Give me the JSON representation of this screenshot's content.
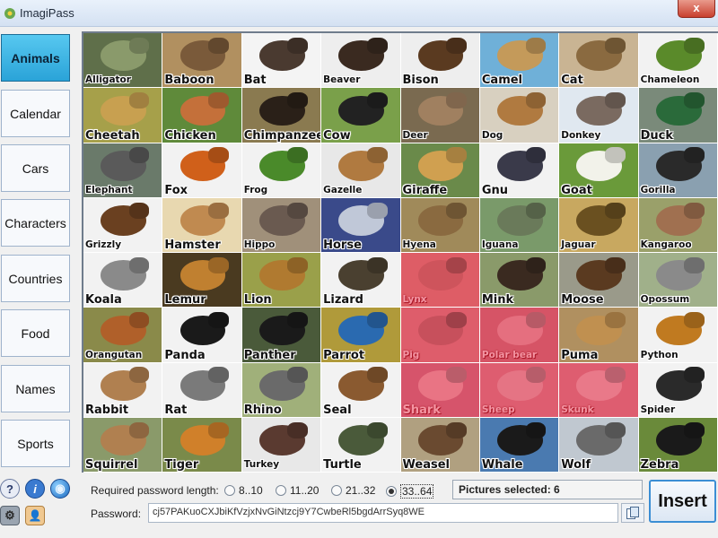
{
  "window": {
    "title": "ImagiPass",
    "close_glyph": "x"
  },
  "categories": [
    {
      "label": "Animals",
      "active": true
    },
    {
      "label": "Calendar",
      "active": false
    },
    {
      "label": "Cars",
      "active": false
    },
    {
      "label": "Characters",
      "active": false
    },
    {
      "label": "Countries",
      "active": false
    },
    {
      "label": "Food",
      "active": false
    },
    {
      "label": "Names",
      "active": false
    },
    {
      "label": "Sports",
      "active": false
    }
  ],
  "tiles": [
    {
      "label": "Alligator",
      "bg": "#5f6f4a",
      "fg": "#8a9a6b",
      "small": true,
      "selected": false
    },
    {
      "label": "Baboon",
      "bg": "#b19060",
      "fg": "#7a5a3a",
      "small": false,
      "selected": false
    },
    {
      "label": "Bat",
      "bg": "#f4f4f4",
      "fg": "#4a3a30",
      "small": false,
      "selected": false
    },
    {
      "label": "Beaver",
      "bg": "#eeeeee",
      "fg": "#3a2a20",
      "small": true,
      "selected": false
    },
    {
      "label": "Bison",
      "bg": "#eeeeee",
      "fg": "#5a3a20",
      "small": false,
      "selected": false
    },
    {
      "label": "Camel",
      "bg": "#6fb0d8",
      "fg": "#c49a5a",
      "small": false,
      "selected": false
    },
    {
      "label": "Cat",
      "bg": "#c9b493",
      "fg": "#8a6a40",
      "small": false,
      "selected": false
    },
    {
      "label": "Chameleon",
      "bg": "#f2f2f2",
      "fg": "#5a8a2a",
      "small": true,
      "selected": false
    },
    {
      "label": "Cheetah",
      "bg": "#a6a04a",
      "fg": "#c8a050",
      "small": false,
      "selected": false
    },
    {
      "label": "Chicken",
      "bg": "#5f8a3a",
      "fg": "#c4703a",
      "small": false,
      "selected": false
    },
    {
      "label": "Chimpanzee",
      "bg": "#8a7a50",
      "fg": "#2a2018",
      "small": false,
      "selected": false
    },
    {
      "label": "Cow",
      "bg": "#7aa04a",
      "fg": "#222222",
      "small": false,
      "selected": false
    },
    {
      "label": "Deer",
      "bg": "#7a6a50",
      "fg": "#a08060",
      "small": true,
      "selected": false
    },
    {
      "label": "Dog",
      "bg": "#d8d0c0",
      "fg": "#b07a40",
      "small": true,
      "selected": false
    },
    {
      "label": "Donkey",
      "bg": "#e0e8f0",
      "fg": "#7a6a60",
      "small": true,
      "selected": false
    },
    {
      "label": "Duck",
      "bg": "#7a8a7a",
      "fg": "#2a6a3a",
      "small": false,
      "selected": false
    },
    {
      "label": "Elephant",
      "bg": "#6a7a6a",
      "fg": "#5a5a5a",
      "small": true,
      "selected": false
    },
    {
      "label": "Fox",
      "bg": "#f2f2f2",
      "fg": "#d0601a",
      "small": false,
      "selected": false
    },
    {
      "label": "Frog",
      "bg": "#f2f2f2",
      "fg": "#4a8a2a",
      "small": true,
      "selected": false
    },
    {
      "label": "Gazelle",
      "bg": "#e8e8e8",
      "fg": "#b07a40",
      "small": true,
      "selected": false
    },
    {
      "label": "Giraffe",
      "bg": "#6a8a4a",
      "fg": "#d0a050",
      "small": false,
      "selected": false
    },
    {
      "label": "Gnu",
      "bg": "#f2f2f2",
      "fg": "#3a3a4a",
      "small": false,
      "selected": false
    },
    {
      "label": "Goat",
      "bg": "#6a9a3a",
      "fg": "#f2f2ea",
      "small": false,
      "selected": false
    },
    {
      "label": "Gorilla",
      "bg": "#8aa0b0",
      "fg": "#2a2a2a",
      "small": true,
      "selected": false
    },
    {
      "label": "Grizzly",
      "bg": "#f2f2f2",
      "fg": "#6a4020",
      "small": true,
      "selected": false
    },
    {
      "label": "Hamster",
      "bg": "#e8d8b0",
      "fg": "#c08a50",
      "small": false,
      "selected": false
    },
    {
      "label": "Hippo",
      "bg": "#a0907a",
      "fg": "#6a5a50",
      "small": true,
      "selected": false
    },
    {
      "label": "Horse",
      "bg": "#3a4a8a",
      "fg": "#c0c8d8",
      "small": false,
      "selected": false
    },
    {
      "label": "Hyena",
      "bg": "#a08a5a",
      "fg": "#8a6a40",
      "small": true,
      "selected": false
    },
    {
      "label": "Iguana",
      "bg": "#7a9a6a",
      "fg": "#6a7a5a",
      "small": true,
      "selected": false
    },
    {
      "label": "Jaguar",
      "bg": "#c8a860",
      "fg": "#6a5020",
      "small": true,
      "selected": false
    },
    {
      "label": "Kangaroo",
      "bg": "#9aa06a",
      "fg": "#a07050",
      "small": true,
      "selected": false
    },
    {
      "label": "Koala",
      "bg": "#f2f2f2",
      "fg": "#8a8a8a",
      "small": false,
      "selected": false
    },
    {
      "label": "Lemur",
      "bg": "#4a3a20",
      "fg": "#c08030",
      "small": false,
      "selected": false
    },
    {
      "label": "Lion",
      "bg": "#9aa04a",
      "fg": "#b07a30",
      "small": false,
      "selected": false
    },
    {
      "label": "Lizard",
      "bg": "#f2f2f2",
      "fg": "#4a4030",
      "small": false,
      "selected": false
    },
    {
      "label": "Lynx",
      "bg": "#e8a0a0",
      "fg": "#d89090",
      "small": true,
      "selected": true
    },
    {
      "label": "Mink",
      "bg": "#8a9a6a",
      "fg": "#3a2a20",
      "small": false,
      "selected": false
    },
    {
      "label": "Moose",
      "bg": "#9a9a8a",
      "fg": "#5a3a20",
      "small": false,
      "selected": false
    },
    {
      "label": "Opossum",
      "bg": "#a0b08a",
      "fg": "#8a8a8a",
      "small": true,
      "selected": false
    },
    {
      "label": "Orangutan",
      "bg": "#8a8a4a",
      "fg": "#b0602a",
      "small": true,
      "selected": false
    },
    {
      "label": "Panda",
      "bg": "#f2f2f2",
      "fg": "#1a1a1a",
      "small": false,
      "selected": false
    },
    {
      "label": "Panther",
      "bg": "#4a5a3a",
      "fg": "#1a1a1a",
      "small": false,
      "selected": false
    },
    {
      "label": "Parrot",
      "bg": "#b09a3a",
      "fg": "#2a6ab0",
      "small": false,
      "selected": false
    },
    {
      "label": "Pig",
      "bg": "#e8a0a8",
      "fg": "#d08a90",
      "small": true,
      "selected": true
    },
    {
      "label": "Polar bear",
      "bg": "#e090a0",
      "fg": "#f0c0c8",
      "small": true,
      "selected": true
    },
    {
      "label": "Puma",
      "bg": "#b09060",
      "fg": "#c09050",
      "small": false,
      "selected": false
    },
    {
      "label": "Python",
      "bg": "#f2f2f2",
      "fg": "#c07a20",
      "small": true,
      "selected": false
    },
    {
      "label": "Rabbit",
      "bg": "#f2f2f2",
      "fg": "#b08050",
      "small": false,
      "selected": false
    },
    {
      "label": "Rat",
      "bg": "#f2f2f2",
      "fg": "#7a7a7a",
      "small": false,
      "selected": false
    },
    {
      "label": "Rhino",
      "bg": "#a0b07a",
      "fg": "#6a6a6a",
      "small": false,
      "selected": false
    },
    {
      "label": "Seal",
      "bg": "#f2f2f2",
      "fg": "#8a5a30",
      "small": false,
      "selected": false
    },
    {
      "label": "Shark",
      "bg": "#e090a8",
      "fg": "#f4c8d0",
      "small": false,
      "selected": true
    },
    {
      "label": "Sheep",
      "bg": "#e8a0b0",
      "fg": "#f0c8d0",
      "small": true,
      "selected": true
    },
    {
      "label": "Skunk",
      "bg": "#e8a0b0",
      "fg": "#f4d0d8",
      "small": true,
      "selected": true
    },
    {
      "label": "Spider",
      "bg": "#f2f2f2",
      "fg": "#2a2a2a",
      "small": true,
      "selected": false
    },
    {
      "label": "Squirrel",
      "bg": "#8a9a6a",
      "fg": "#b08050",
      "small": false,
      "selected": false
    },
    {
      "label": "Tiger",
      "bg": "#7a8a4a",
      "fg": "#d0802a",
      "small": false,
      "selected": false
    },
    {
      "label": "Turkey",
      "bg": "#e8e8e8",
      "fg": "#5a3a30",
      "small": true,
      "selected": false
    },
    {
      "label": "Turtle",
      "bg": "#f2f2f2",
      "fg": "#4a5a3a",
      "small": false,
      "selected": false
    },
    {
      "label": "Weasel",
      "bg": "#b0a080",
      "fg": "#6a4a30",
      "small": false,
      "selected": false
    },
    {
      "label": "Whale",
      "bg": "#4a7ab0",
      "fg": "#1a1a1a",
      "small": false,
      "selected": false
    },
    {
      "label": "Wolf",
      "bg": "#c0c8d0",
      "fg": "#6a6a6a",
      "small": false,
      "selected": false
    },
    {
      "label": "Zebra",
      "bg": "#6a8a3a",
      "fg": "#1a1a1a",
      "small": false,
      "selected": false
    }
  ],
  "bottom": {
    "tools": [
      {
        "name": "help-icon",
        "glyph": "?"
      },
      {
        "name": "info-icon",
        "glyph": "i"
      },
      {
        "name": "globe-icon",
        "glyph": "◉"
      },
      {
        "name": "settings-icon",
        "glyph": "⚙"
      },
      {
        "name": "user-icon",
        "glyph": "👤"
      }
    ],
    "req_label": "Required password length:",
    "length_options": [
      {
        "label": "8..10",
        "checked": false
      },
      {
        "label": "11..20",
        "checked": false
      },
      {
        "label": "21..32",
        "checked": false
      },
      {
        "label": "33..64",
        "checked": true
      }
    ],
    "pictures_selected": "Pictures selected: 6",
    "password_label": "Password:",
    "password_value": "cj57PAKuoCXJbiKfVzjxNvGiNtzcj9Y7CwbeRl5bgdArrSyq8WE",
    "insert_label": "Insert"
  },
  "colors": {
    "active_category": "#2aa3d8",
    "selection_tint": "#eb3c55",
    "insert_border": "#3b8ed4"
  }
}
